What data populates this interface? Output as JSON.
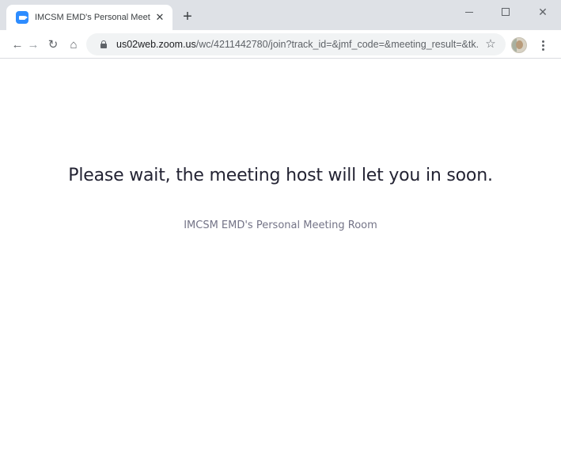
{
  "browser": {
    "tab": {
      "title": "IMCSM EMD's Personal Meeting Room",
      "close_glyph": "✕",
      "favicon": "zoom-camera-icon"
    },
    "new_tab_glyph": "+",
    "window_controls": {
      "close_glyph": "✕"
    },
    "nav": {
      "back_glyph": "←",
      "forward_glyph": "→",
      "reload_glyph": "↻",
      "home_glyph": "⌂"
    },
    "address_bar": {
      "host": "us02web.zoom.us",
      "path": "/wc/4211442780/join?track_id=&jmf_code=&meeting_result=&tk...",
      "bookmark_glyph": "☆"
    }
  },
  "page": {
    "wait_message": "Please wait, the meeting host will let you in soon.",
    "room_name": "IMCSM EMD's Personal Meeting Room"
  },
  "colors": {
    "tabstrip_bg": "#dee1e6",
    "zoom_blue": "#2d8cff",
    "title_text": "#232333",
    "subtitle_text": "#747487"
  }
}
